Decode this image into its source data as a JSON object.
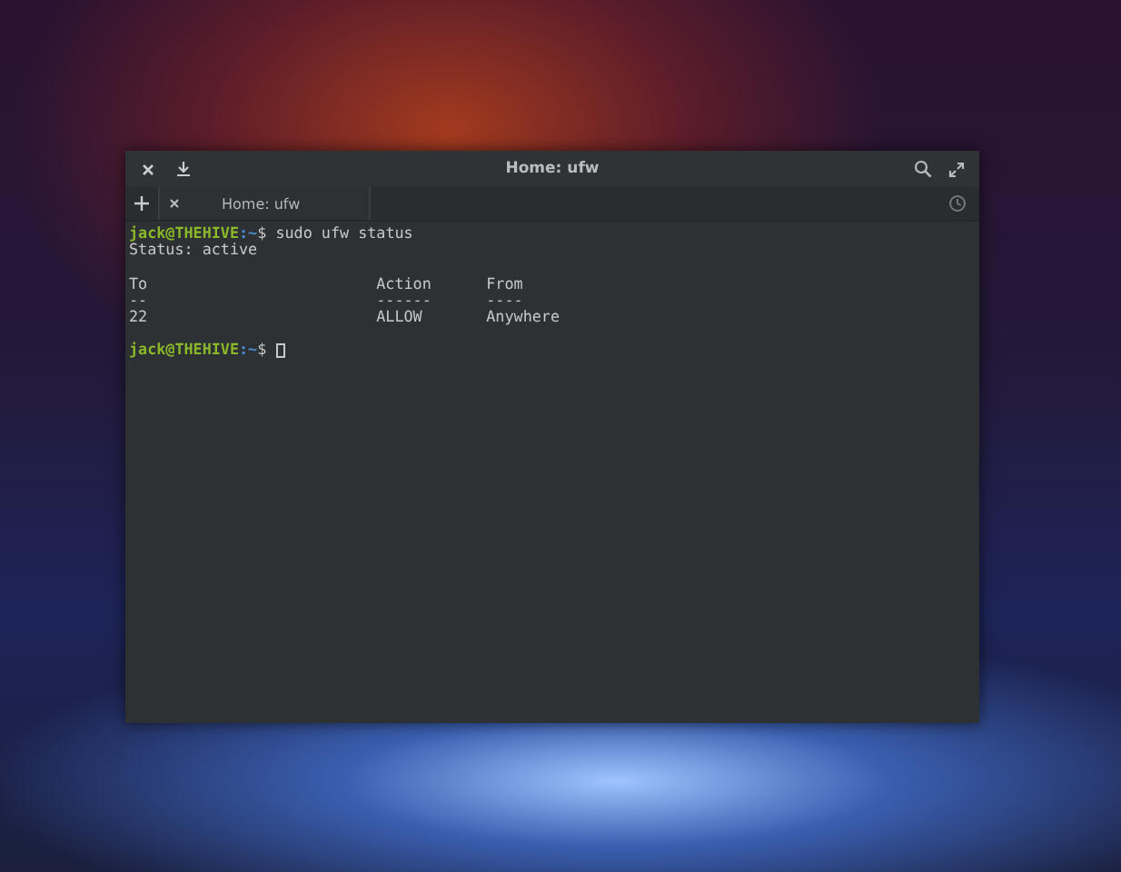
{
  "window": {
    "title": "Home: ufw"
  },
  "tabs": [
    {
      "label": "Home: ufw",
      "selected": true
    }
  ],
  "terminal": {
    "lines": [
      {
        "kind": "prompt",
        "user": "jack@THEHIVE",
        "path": ":~",
        "command": "$ sudo ufw status",
        "cursor": false
      },
      {
        "kind": "output",
        "text": "Status: active"
      },
      {
        "kind": "blank"
      },
      {
        "kind": "output",
        "text": "To                         Action      From"
      },
      {
        "kind": "output",
        "text": "--                         ------      ----"
      },
      {
        "kind": "output",
        "text": "22                         ALLOW       Anywhere"
      },
      {
        "kind": "blank"
      },
      {
        "kind": "prompt",
        "user": "jack@THEHIVE",
        "path": ":~",
        "command": "$ ",
        "cursor": true
      }
    ]
  }
}
